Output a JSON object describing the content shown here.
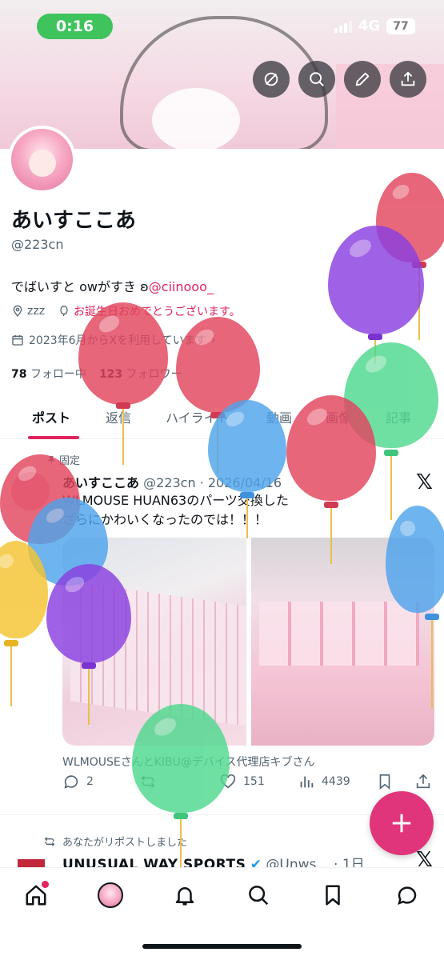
{
  "status": {
    "time": "0:16",
    "network": "4G",
    "battery": "77"
  },
  "profile": {
    "name": "あいすここあ",
    "handle": "@223cn",
    "bio_text": "でばいすと owがすき ",
    "bio_emoji": "ʚ",
    "bio_mention": "@ciinooo_",
    "location": "zzz",
    "birthday": "お誕生日おめでとうございます。",
    "joined": "2023年6月からXを利用しています",
    "following_count": "78",
    "following_label": "フォロー中",
    "followers_count": "123",
    "followers_label": "フォロワー"
  },
  "tabs": [
    "ポスト",
    "返信",
    "ハイライト",
    "動画",
    "画像",
    "記事"
  ],
  "pinned_post": {
    "pinned_label": "固定",
    "author": "あいすここあ",
    "handle": "@223cn",
    "date": "· 2026/04/16",
    "text_line1": "WLMOUSE HUAN63のパーツ交換した",
    "text_line2": "さらにかわいくなったのでは！！！",
    "tagged": "WLMOUSEさんとKIBU@デバイス代理店キブさん",
    "replies": "2",
    "retweets": "",
    "likes": "151",
    "views": "4439"
  },
  "second_post": {
    "repost_note": "あなたがリポストしました",
    "author": "UNUSUAL WAY SPORTS",
    "handle": "@Unws...",
    "time": "· 1日"
  },
  "colors": {
    "accent": "#e0245e",
    "fab": "#e0357a",
    "status_pill": "#3fc35c"
  },
  "icons": {
    "banner": [
      "hide-icon",
      "search-icon",
      "edit-icon",
      "share-icon"
    ],
    "nav": [
      "home-icon",
      "profile-avatar",
      "bell-icon",
      "search-icon",
      "bookmark-icon",
      "chat-icon"
    ]
  }
}
